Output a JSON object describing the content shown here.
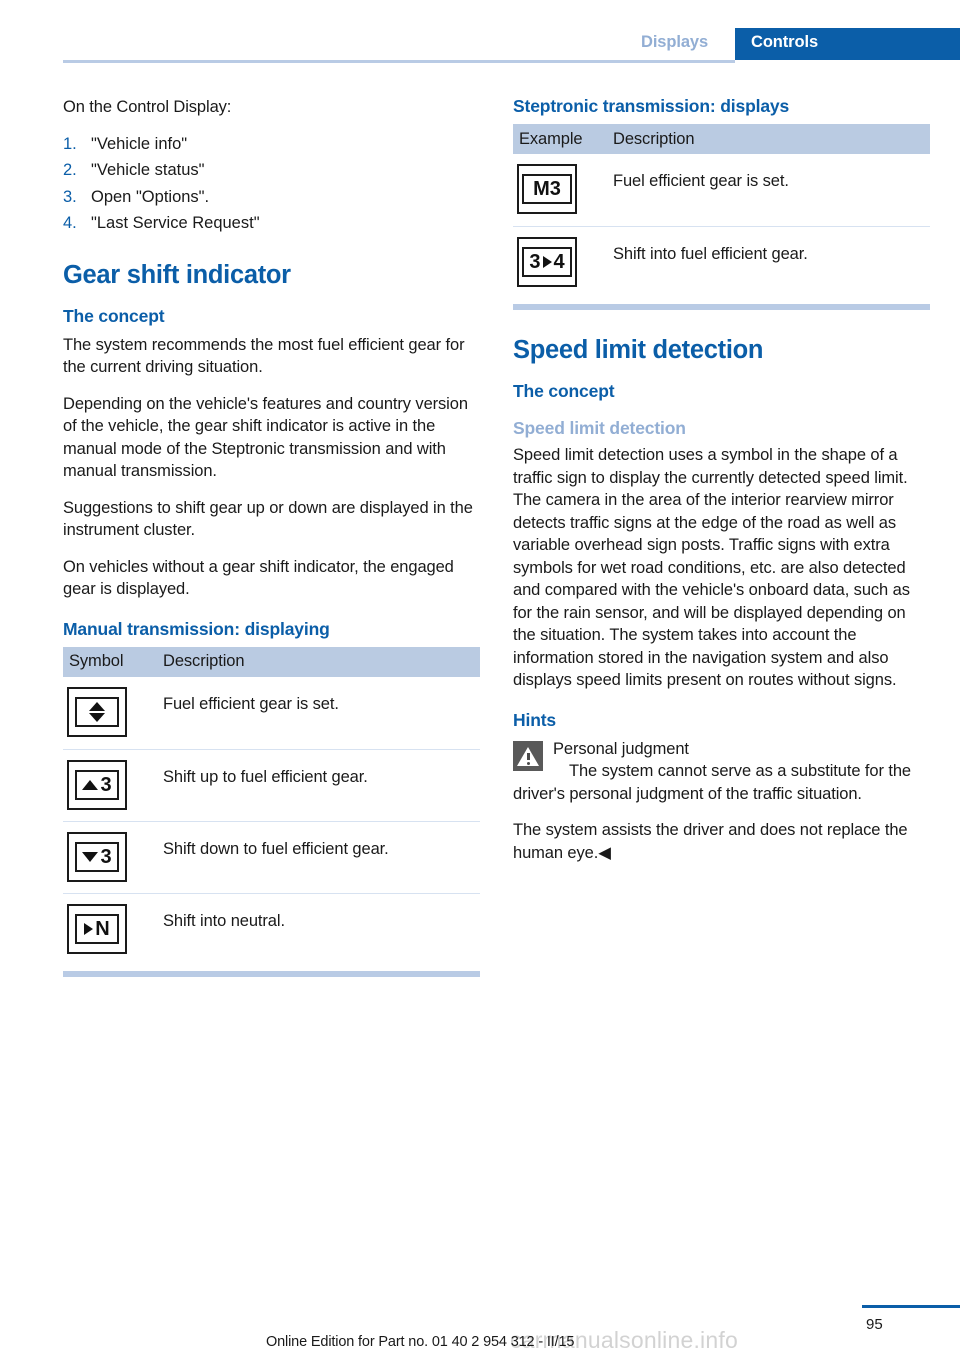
{
  "header": {
    "tab_inactive": "Displays",
    "tab_active": "Controls",
    "accent_blue": "#0b5ea8",
    "muted_blue": "#92aed4"
  },
  "left_column": {
    "intro": "On the Control Display:",
    "steps": [
      {
        "num": "1.",
        "text": "\"Vehicle info\""
      },
      {
        "num": "2.",
        "text": "\"Vehicle status\""
      },
      {
        "num": "3.",
        "text": "Open \"Options\"."
      },
      {
        "num": "4.",
        "text": "\"Last Service Request\""
      }
    ],
    "section_title": "Gear shift indicator",
    "concept_title": "The concept",
    "concept_paragraphs": [
      "The system recommends the most fuel efficient gear for the current driving situation.",
      "Depending on the vehicle's features and country version of the vehicle, the gear shift indicator is active in the manual mode of the Steptronic transmission and with manual transmission.",
      "Suggestions to shift gear up or down are displayed in the instrument cluster.",
      "On vehicles without a gear shift indicator, the engaged gear is displayed."
    ],
    "manual_title": "Manual transmission: displaying",
    "manual_table": {
      "columns": [
        "Symbol",
        "Description"
      ],
      "rows": [
        {
          "symbol": "up-down-arrow-icon",
          "gear": "",
          "description": "Fuel efficient gear is set."
        },
        {
          "symbol": "arrow-up-gear-icon",
          "gear": "3",
          "description": "Shift up to fuel efficient gear."
        },
        {
          "symbol": "arrow-down-gear-icon",
          "gear": "3",
          "description": "Shift down to fuel efficient gear."
        },
        {
          "symbol": "arrow-right-neutral-icon",
          "gear": "N",
          "description": "Shift into neutral."
        }
      ]
    }
  },
  "right_column": {
    "steptronic_title": "Steptronic transmission: displays",
    "steptronic_table": {
      "columns": [
        "Example",
        "Description"
      ],
      "rows": [
        {
          "symbol": "gear-m3-icon",
          "label": "M3",
          "description": "Fuel efficient gear is set."
        },
        {
          "symbol": "gear-3-to-4-icon",
          "from": "3",
          "to": "4",
          "description": "Shift into fuel efficient gear."
        }
      ]
    },
    "speed_limit_title": "Speed limit detection",
    "concept_title": "The concept",
    "sub_heading": "Speed limit detection",
    "body_paragraph": "Speed limit detection uses a symbol in the shape of a traffic sign to display the currently detected speed limit. The camera in the area of the interior rearview mirror detects traffic signs at the edge of the road as well as variable overhead sign posts. Traffic signs with extra symbols for wet road conditions, etc. are also detected and compared with the vehicle's onboard data, such as for the rain sensor, and will be displayed depending on the situation. The system takes into account the information stored in the navigation system and also displays speed limits present on routes without signs.",
    "hints_title": "Hints",
    "warning": {
      "icon": "warning-triangle-icon",
      "title": "Personal judgment",
      "text": "The system cannot serve as a substitute for the driver's personal judgment of the traffic situation."
    },
    "closing_paragraph": "The system assists the driver and does not replace the human eye.◀"
  },
  "footer": {
    "edition_text": "Online Edition for Part no. 01 40 2 954 312 - II/15",
    "page_number": "95",
    "watermark": "carmanualsonline.info"
  }
}
